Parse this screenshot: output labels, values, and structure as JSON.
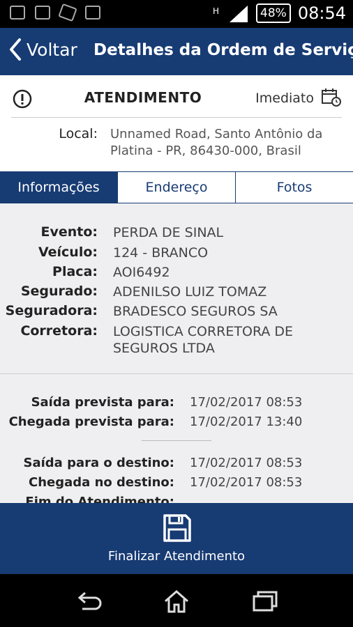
{
  "status_bar": {
    "battery": "48%",
    "time": "08:54"
  },
  "app_bar": {
    "back_label": "Voltar",
    "title": "Detalhes da Ordem de Serviço"
  },
  "header_card": {
    "title": "ATENDIMENTO",
    "priority": "Imediato",
    "local_label": "Local:",
    "local_value": "Unnamed Road, Santo Antônio da Platina - PR, 86430-000, Brasil"
  },
  "tabs": [
    {
      "label": "Informações",
      "active": true
    },
    {
      "label": "Endereço",
      "active": false
    },
    {
      "label": "Fotos",
      "active": false
    }
  ],
  "info": [
    {
      "label": "Evento:",
      "value": "PERDA DE SINAL"
    },
    {
      "label": "Veículo:",
      "value": "124 - BRANCO"
    },
    {
      "label": "Placa:",
      "value": "AOI6492"
    },
    {
      "label": "Segurado:",
      "value": "ADENILSO LUIZ TOMAZ"
    },
    {
      "label": "Seguradora:",
      "value": "BRADESCO SEGUROS SA"
    },
    {
      "label": "Corretora:",
      "value": "LOGISTICA CORRETORA DE SEGUROS LTDA"
    }
  ],
  "schedule": [
    {
      "label": "Saída prevista para:",
      "value": "17/02/2017 08:53"
    },
    {
      "label": "Chegada prevista para:",
      "value": "17/02/2017 13:40"
    }
  ],
  "actual": [
    {
      "label": "Saída para o destino:",
      "value": "17/02/2017 08:53"
    },
    {
      "label": "Chegada no destino:",
      "value": "17/02/2017 08:53"
    },
    {
      "label": "Fim do Atendimento:",
      "value": ""
    }
  ],
  "bottom_action": {
    "label": "Finalizar Atendimento"
  },
  "colors": {
    "primary": "#173b73",
    "background": "#efeff1"
  }
}
